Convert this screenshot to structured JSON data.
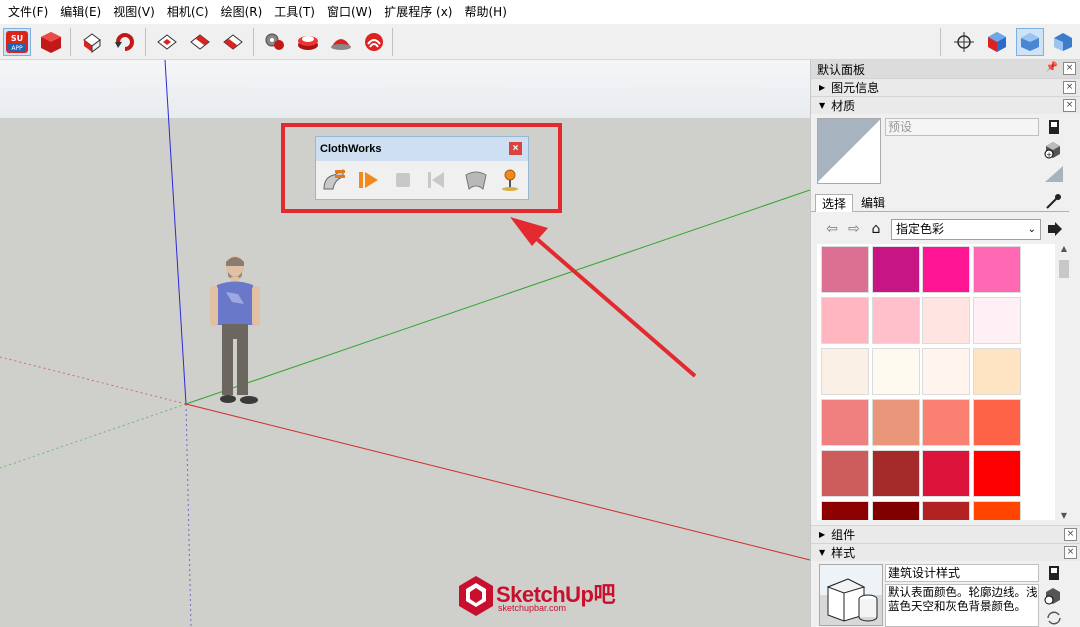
{
  "menu": [
    "文件(F)",
    "编辑(E)",
    "视图(V)",
    "相机(C)",
    "绘图(R)",
    "工具(T)",
    "窗口(W)",
    "扩展程序 (x)",
    "帮助(H)"
  ],
  "toolbar_icons": [
    "suapp-icon",
    "red-box-icon",
    "unwrap-icon",
    "rotate-icon",
    "face-tool-icon",
    "face-tool-2-icon",
    "face-tool-3-icon",
    "gear-cluster-icon",
    "cake-layer-icon",
    "cap-icon",
    "ribbon-icon",
    "xray-target-icon",
    "view-iso-icon",
    "view-top-icon",
    "view-front-icon"
  ],
  "clothworks": {
    "title": "ClothWorks",
    "icons": [
      "cloth-setup-icon",
      "play-icon",
      "stop-icon",
      "rewind-icon",
      "cloth-drape-icon",
      "pin-icon"
    ]
  },
  "watermark": {
    "logo": "SketchUp吧",
    "url": "sketchupbar.com"
  },
  "tray": {
    "title": "默认面板",
    "entity_info": "图元信息",
    "materials": "材质",
    "preset": "预设",
    "tab_select": "选择",
    "tab_edit": "编辑",
    "category": "指定色彩",
    "components": "组件",
    "styles": "样式",
    "style_name": "建筑设计样式",
    "style_desc": "默认表面颜色。轮廓边线。浅蓝色天空和灰色背景颜色。"
  },
  "swatches": [
    [
      "#db7093",
      "#c71585",
      "#ff1493",
      "#ff69b4"
    ],
    [
      "#ffb6c1",
      "#ffc0cb",
      "#ffe4e1",
      "#fff0f5"
    ],
    [
      "#faf0e6",
      "#fffaf0",
      "#fff5ee",
      "#ffe4c4"
    ],
    [
      "#f08080",
      "#e9967a",
      "#fa8072",
      "#ff6347"
    ],
    [
      "#cd5c5c",
      "#a52a2a",
      "#dc143c",
      "#ff0000"
    ],
    [
      "#8b0000",
      "#800000",
      "#b22222",
      "#ff4500"
    ]
  ],
  "colors": {
    "accent_red": "#e22a2f",
    "panel_title": "#cddff1"
  }
}
